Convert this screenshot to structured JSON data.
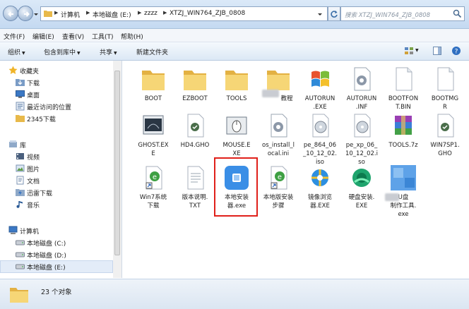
{
  "address": {
    "breadcrumbs": [
      "计算机",
      "本地磁盘 (E:)",
      "zzzz",
      "XTZJ_WIN764_ZJB_0808"
    ],
    "search_placeholder": "搜索 XTZJ_WIN764_ZJB_0808"
  },
  "menu": [
    "文件(F)",
    "编辑(E)",
    "查看(V)",
    "工具(T)",
    "帮助(H)"
  ],
  "toolbar": {
    "organize": "组织",
    "include_in_library": "包含到库中",
    "share": "共享",
    "new_folder": "新建文件夹"
  },
  "nav": {
    "favorites": "收藏夹",
    "fav_items": [
      "下载",
      "桌面",
      "最近访问的位置",
      "2345下载"
    ],
    "libraries": "库",
    "lib_items": [
      "视频",
      "图片",
      "文档",
      "迅雷下载",
      "音乐"
    ],
    "computer": "计算机",
    "drives": [
      "本地磁盘 (C:)",
      "本地磁盘 (D:)",
      "本地磁盘 (E:)"
    ]
  },
  "files": [
    {
      "name": "BOOT",
      "icon": "folder-icon"
    },
    {
      "name": "EZBOOT",
      "icon": "folder-icon"
    },
    {
      "name": "TOOLS",
      "icon": "folder-icon"
    },
    {
      "name": "教程",
      "icon": "folder-icon"
    },
    {
      "name": "AUTORUN\n.EXE",
      "icon": "windows-exe-icon"
    },
    {
      "name": "AUTORUN\n.INF",
      "icon": "settings-file-icon"
    },
    {
      "name": "BOOTFON\nT.BIN",
      "icon": "blank-file-icon"
    },
    {
      "name": "BOOTMG\nR",
      "icon": "blank-file-icon"
    },
    {
      "name": "GHOST.EX\nE",
      "icon": "ghost-exe-icon"
    },
    {
      "name": "HD4.GHO",
      "icon": "gho-file-icon"
    },
    {
      "name": "MOUSE.E\nXE",
      "icon": "mouse-exe-icon"
    },
    {
      "name": "os_install_l\nocal.ini",
      "icon": "settings-file-icon"
    },
    {
      "name": "pe_864_06\n_10_12_02.\niso",
      "icon": "iso-file-icon"
    },
    {
      "name": "pe_xp_06_\n10_12_02.i\nso",
      "icon": "iso-file-icon"
    },
    {
      "name": "TOOLS.7z",
      "icon": "archive-icon"
    },
    {
      "name": "WIN7SP1.\nGHO",
      "icon": "gho-file-icon"
    },
    {
      "name": "Win7系统\n下载",
      "icon": "shortcut-ie-icon"
    },
    {
      "name": "版本说明.\nTXT",
      "icon": "text-file-icon"
    },
    {
      "name": "本地安装\n器.exe",
      "icon": "installer-icon"
    },
    {
      "name": "本地版安装\n步骤",
      "icon": "shortcut-ie-icon"
    },
    {
      "name": "镜像浏览\n器.EXE",
      "icon": "image-browser-icon"
    },
    {
      "name": "硬盘安装.\nEXE",
      "icon": "disk-install-icon"
    },
    {
      "name": "U盘\n制作工具.\nexe",
      "icon": "usb-tool-icon"
    }
  ],
  "status": {
    "count": "23 个对象"
  },
  "colors": {
    "highlight": "#e0201a",
    "folder": "#f2c94c",
    "accent": "#3a8ee6"
  }
}
